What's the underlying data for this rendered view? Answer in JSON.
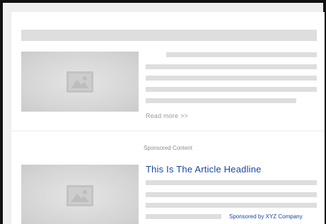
{
  "article": {
    "read_more": "Read more >>"
  },
  "sponsored": {
    "section_label": "Sponsored Content",
    "headline": "This Is The Article Headline",
    "credit": "Sponsored by XYZ Company"
  },
  "icons": {
    "thumbnail": "image-placeholder-icon"
  },
  "colors": {
    "placeholder_bar": "#dedede",
    "link_blue": "#1a47a0",
    "muted_text": "#9a9a9a"
  }
}
